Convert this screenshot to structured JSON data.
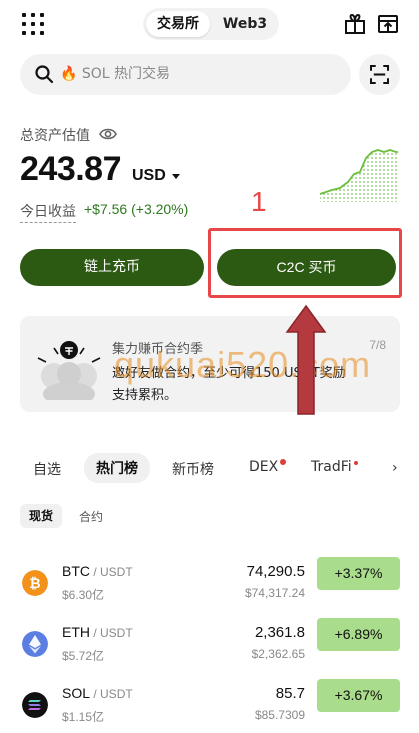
{
  "header": {
    "tabs": [
      "交易所",
      "Web3"
    ],
    "active_tab": "交易所"
  },
  "search": {
    "placeholder": "🔥 SOL 热门交易"
  },
  "balance": {
    "label": "总资产估值",
    "value": "243.87",
    "currency": "USD",
    "pnl_label": "今日收益",
    "pnl_value": "+$7.56 (+3.20%)"
  },
  "actions": {
    "deposit_label": "链上充币",
    "buy_label": "C2C 买币"
  },
  "annotation": {
    "number": "1",
    "color": "#e8474a"
  },
  "promo": {
    "title": "集力赚币合约季",
    "page": "7/8",
    "line1": "邀好友做合约，至少可得150 USDT奖励",
    "line2": "支持累积。"
  },
  "watermark": "qukuai520.com",
  "market_tabs": {
    "items": [
      "自选",
      "热门榜",
      "新币榜",
      "DEX",
      "TradFi"
    ],
    "active": "热门榜"
  },
  "sub_tabs": {
    "items": [
      "现货",
      "合约"
    ],
    "active": "现货"
  },
  "rows": [
    {
      "symbol": "BTC",
      "pair": " / USDT",
      "volume": "$6.30亿",
      "price": "74,290.5",
      "fiat": "$74,317.24",
      "change": "+3.37%",
      "icon_color": "#f2921b",
      "icon": "bitcoin-icon"
    },
    {
      "symbol": "ETH",
      "pair": " / USDT",
      "volume": "$5.72亿",
      "price": "2,361.8",
      "fiat": "$2,362.65",
      "change": "+6.89%",
      "icon_color": "#5b7ee0",
      "icon": "ethereum-icon"
    },
    {
      "symbol": "SOL",
      "pair": " / USDT",
      "volume": "$1.15亿",
      "price": "85.7",
      "fiat": "$85.7309",
      "change": "+3.67%",
      "icon_color": "#111111",
      "icon": "solana-icon"
    }
  ],
  "colors": {
    "brand_green": "#2d5a13",
    "positive_text": "#2d7a1e",
    "positive_bg": "#a9dc8b"
  }
}
